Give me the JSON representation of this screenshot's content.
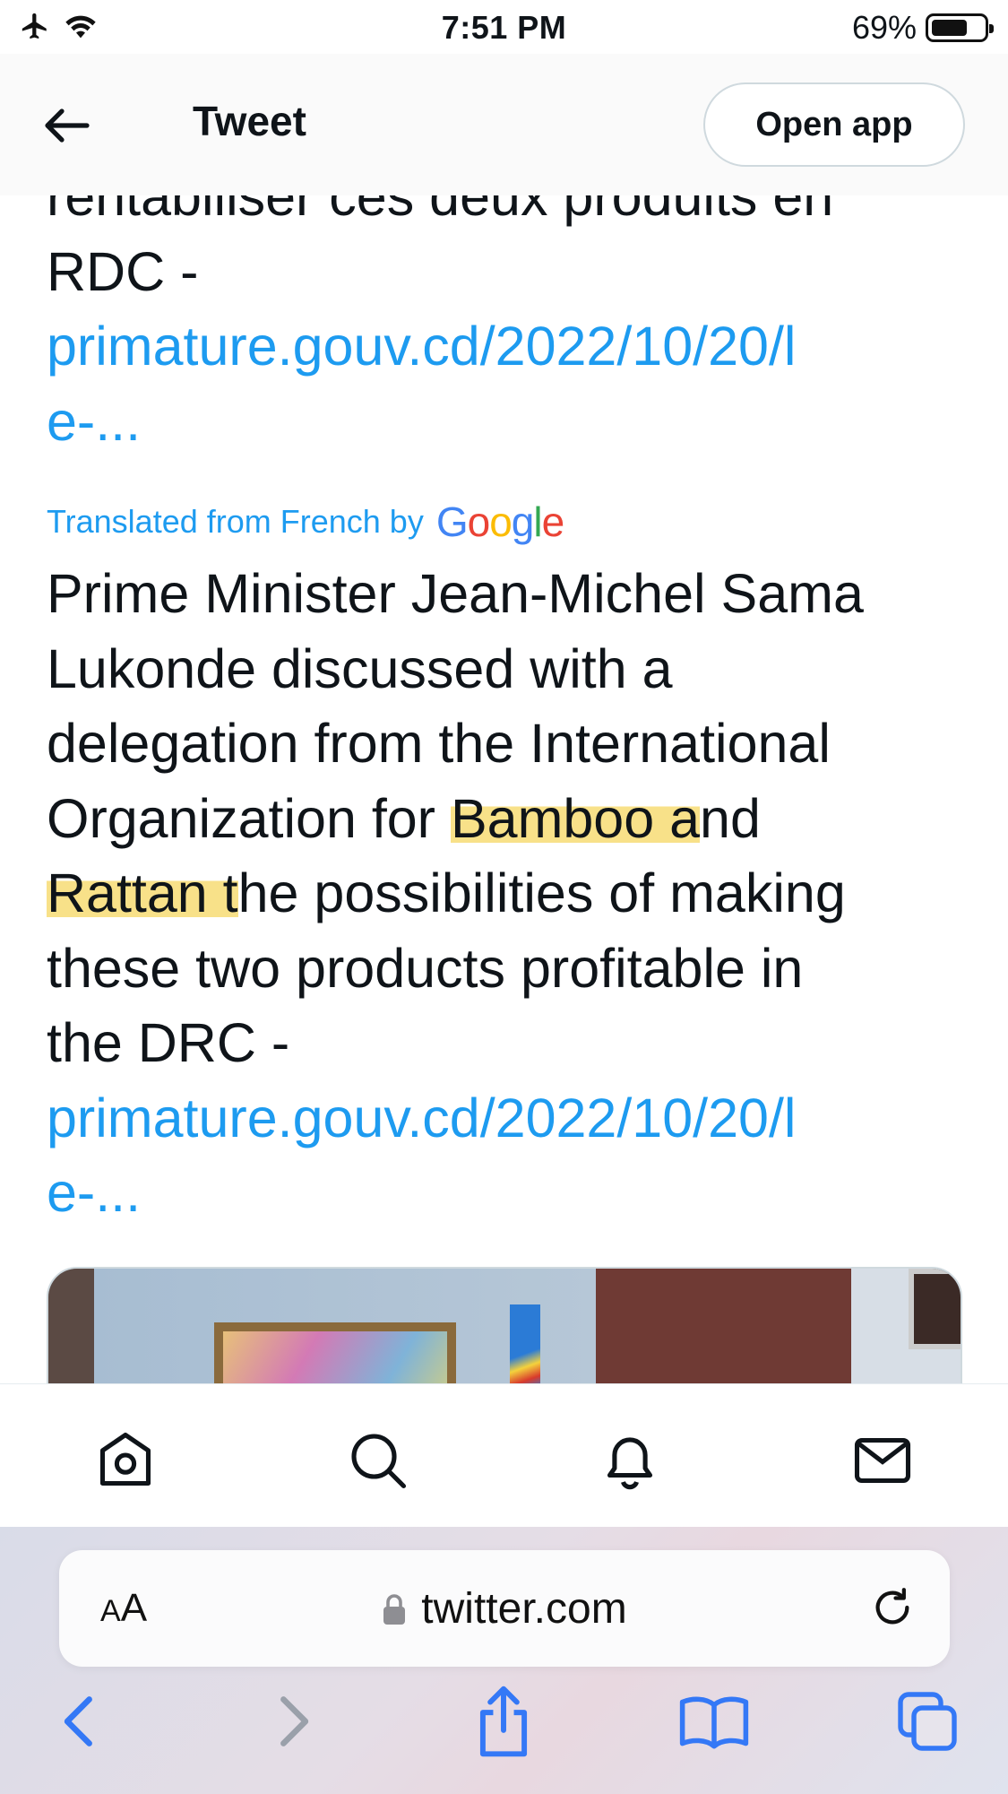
{
  "status_bar": {
    "time": "7:51 PM",
    "battery_text": "69%",
    "battery_level": 0.69
  },
  "header": {
    "title": "Tweet",
    "open_app_label": "Open app"
  },
  "tweet": {
    "original_lines": [
      "rentabiliser ces deux produits en",
      "RDC -"
    ],
    "original_link_lines": [
      "primature.gouv.cd/2022/10/20/l",
      "e-..."
    ],
    "translated_by_label": "Translated from French by",
    "translated_by_brand": "Google",
    "translation": {
      "l1": "Prime Minister Jean-Michel Sama",
      "l2": "Lukonde discussed with a",
      "l3": "delegation from the International",
      "l4_pre": "Organization for ",
      "l4_hl": "Bamboo a",
      "l4_post": "nd",
      "l5_hl": "Rattan t",
      "l5_post": "he possibilities of making",
      "l6": "these two products profitable in",
      "l7": "the DRC -"
    },
    "translated_link_lines": [
      "primature.gouv.cd/2022/10/20/l",
      "e-..."
    ]
  },
  "tabbar": {
    "items": [
      "home-icon",
      "search-icon",
      "notifications-icon",
      "messages-icon"
    ]
  },
  "safari": {
    "aa_label_big": "A",
    "aa_label_small": "A",
    "url": "twitter.com"
  },
  "colors": {
    "link": "#1d9bf0",
    "highlight": "#f2c828",
    "safari_blue": "#3478f6"
  }
}
